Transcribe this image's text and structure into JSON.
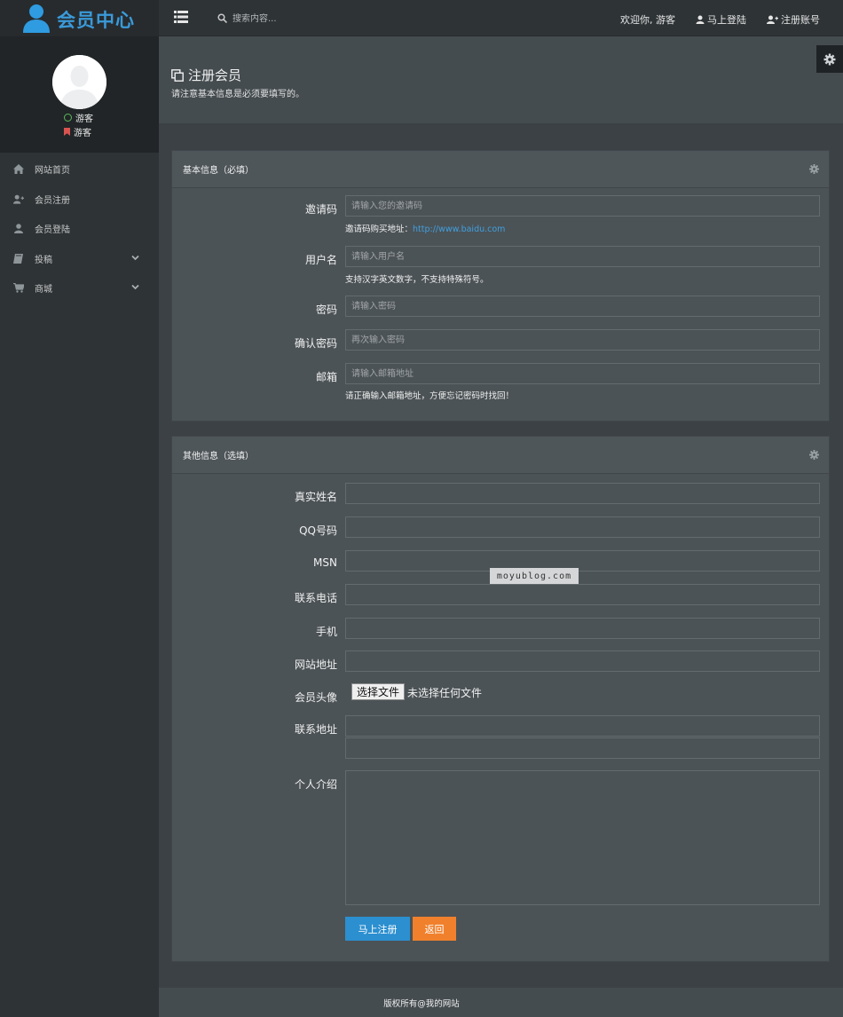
{
  "brand": {
    "title": "会员中心",
    "color": "#3a9ad9"
  },
  "search": {
    "placeholder": "搜索内容..."
  },
  "topnav": {
    "welcome": "欢迎你, 游客",
    "login": "马上登陆",
    "register": "注册账号"
  },
  "profile": {
    "status": "游客",
    "role": "游客"
  },
  "sidebar": {
    "items": [
      {
        "label": "网站首页",
        "icon": "home-icon"
      },
      {
        "label": "会员注册",
        "icon": "user-plus-icon"
      },
      {
        "label": "会员登陆",
        "icon": "user-icon"
      },
      {
        "label": "投稿",
        "icon": "book-icon",
        "expandable": true
      },
      {
        "label": "商城",
        "icon": "cart-icon",
        "expandable": true
      }
    ]
  },
  "page": {
    "title": "注册会员",
    "subtitle": "请注意基本信息是必须要填写的。"
  },
  "basic": {
    "title": "基本信息（必填）",
    "invite_label": "邀请码",
    "invite_placeholder": "请输入您的邀请码",
    "invite_help": "邀请码购买地址：",
    "invite_link": "http://www.baidu.com",
    "username_label": "用户名",
    "username_placeholder": "请输入用户名",
    "username_help": "支持汉字英文数字，不支持特殊符号。",
    "password_label": "密码",
    "password_placeholder": "请输入密码",
    "confirm_label": "确认密码",
    "confirm_placeholder": "再次输入密码",
    "email_label": "邮箱",
    "email_placeholder": "请输入邮箱地址",
    "email_help": "请正确输入邮箱地址，方便忘记密码时找回！"
  },
  "other": {
    "title": "其他信息（选填）",
    "realname_label": "真实姓名",
    "qq_label": "QQ号码",
    "msn_label": "MSN",
    "phone_label": "联系电话",
    "mobile_label": "手机",
    "website_label": "网站地址",
    "avatar_label": "会员头像",
    "file_button": "选择文件",
    "file_status": "未选择任何文件",
    "address_label": "联系地址",
    "intro_label": "个人介绍"
  },
  "actions": {
    "submit": "马上注册",
    "back": "返回"
  },
  "watermark": "moyublog.com",
  "footer": "版权所有@我的网站"
}
